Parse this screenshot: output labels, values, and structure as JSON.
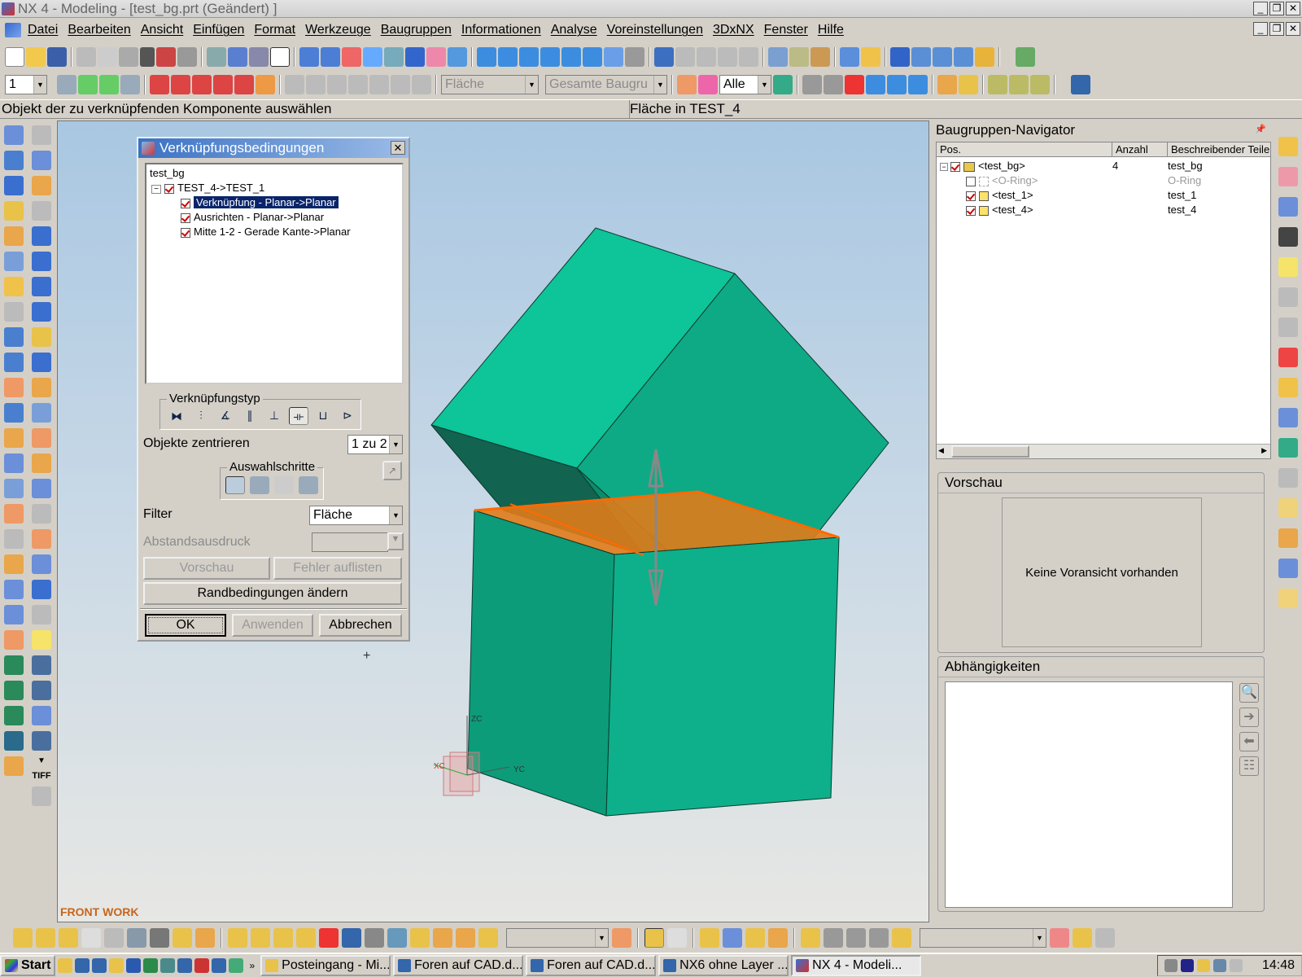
{
  "window": {
    "title": "NX 4 - Modeling - [test_bg.prt (Geändert) ]"
  },
  "menubar": [
    "Datei",
    "Bearbeiten",
    "Ansicht",
    "Einfügen",
    "Format",
    "Werkzeuge",
    "Baugruppen",
    "Informationen",
    "Analyse",
    "Voreinstellungen",
    "3DxNX",
    "Fenster",
    "Hilfe"
  ],
  "toolbar2": {
    "layer_value": "1",
    "filter_face": "Fläche",
    "scope": "Gesamte Baugru",
    "select_all": "Alle"
  },
  "status": {
    "prompt": "Objekt der zu verknüpfenden Komponente auswählen",
    "selection": "Fläche in TEST_4"
  },
  "viewport": {
    "view_label": "FRONT WORK",
    "axis_zc": "ZC",
    "axis_xc": "XC",
    "axis_yc": "YC"
  },
  "dialog": {
    "title": "Verknüpfungsbedingungen",
    "tree_root": "test_bg",
    "tree_parent": "TEST_4->TEST_1",
    "constraints": [
      "Verknüpfung - Planar->Planar",
      "Ausrichten - Planar->Planar",
      "Mitte 1-2 - Gerade Kante->Planar"
    ],
    "mate_type_label": "Verknüpfungstyp",
    "center_label": "Objekte zentrieren",
    "center_value": "1 zu 2",
    "steps_label": "Auswahlschritte",
    "filter_label": "Filter",
    "filter_value": "Fläche",
    "distance_label": "Abstandsausdruck",
    "preview_btn": "Vorschau",
    "errors_btn": "Fehler auflisten",
    "change_btn": "Randbedingungen ändern",
    "ok_btn": "OK",
    "apply_btn": "Anwenden",
    "cancel_btn": "Abbrechen"
  },
  "navigator": {
    "title": "Baugruppen-Navigator",
    "columns": [
      "Pos.",
      "Anzahl",
      "Beschreibender Teile"
    ],
    "rows": [
      {
        "name": "<test_bg>",
        "count": "4",
        "desc": "test_bg"
      },
      {
        "name": "<O-Ring>",
        "count": "",
        "desc": "O-Ring"
      },
      {
        "name": "<test_1>",
        "count": "",
        "desc": "test_1"
      },
      {
        "name": "<test_4>",
        "count": "",
        "desc": "test_4"
      }
    ]
  },
  "preview": {
    "title": "Vorschau",
    "empty_text": "Keine Voransicht vorhanden"
  },
  "dependencies": {
    "title": "Abhängigkeiten"
  },
  "left_extra": "TIFF",
  "taskbar": {
    "start": "Start",
    "items": [
      "Posteingang - Mi...",
      "Foren auf CAD.d...",
      "Foren auf CAD.d...",
      "NX6 ohne Layer ...",
      "NX 4 - Modeli..."
    ],
    "clock": "14:48"
  }
}
